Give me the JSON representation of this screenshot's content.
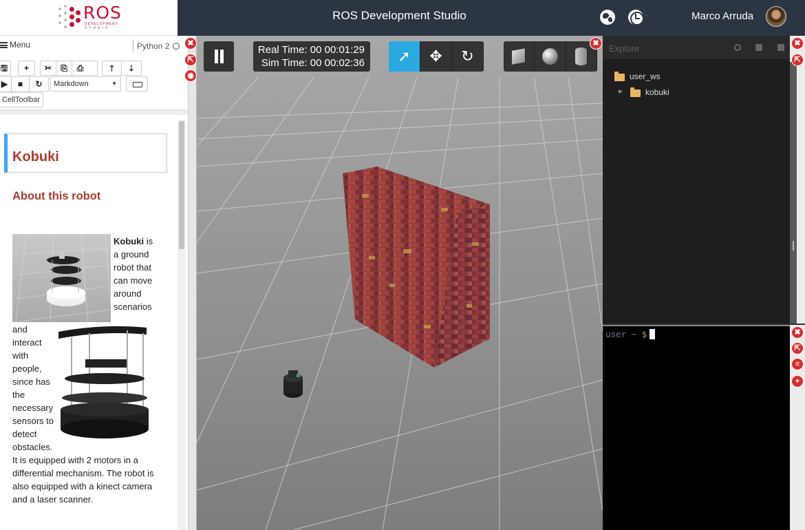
{
  "header": {
    "logo_text": "ROS",
    "logo_sub1": "DEVELOPMENT",
    "logo_sub2": "STUDIO",
    "title": "ROS Development Studio",
    "user_name": "Marco Arruda"
  },
  "notebook": {
    "menu_label": "Menu",
    "kernel": "Python 2",
    "cell_type": "Markdown",
    "celltoolbar_label": "CellToolbar",
    "heading": "Kobuki",
    "subheading": "About this robot",
    "intro_bold": "Kobuki",
    "intro_lines": [
      "is",
      "a ground",
      "robot that",
      "can move",
      "around",
      "scenarios"
    ],
    "wrap_lines": [
      "and",
      "interact",
      "with",
      "people,",
      "since has",
      "the",
      "necessary",
      "sensors to",
      "detect",
      "obstacles."
    ],
    "footer_lines": [
      "It is equipped with 2 motors in a",
      "differential mechanism. The robot is",
      "also equipped with a kinect camera",
      "and a laser scanner."
    ]
  },
  "simulation": {
    "real_time": "Real Time: 00 00:01:29",
    "sim_time": "Sim Time: 00 00:02:36"
  },
  "explorer": {
    "placeholder": "Explore",
    "tree": [
      {
        "label": "user_ws"
      },
      {
        "label": "kobuki"
      }
    ]
  },
  "terminal": {
    "prompt_user": "user ~",
    "prompt_symbol": "$"
  },
  "colors": {
    "accent": "#29a9e0",
    "brand": "#c8102e",
    "close_red": "#d32f2f",
    "heading_red": "#b03a2e"
  },
  "icons": {
    "header": [
      "globe-icon",
      "clock-icon"
    ],
    "gazebo_modes": [
      "select-arrow-icon",
      "translate-icon",
      "rotate-icon"
    ],
    "gazebo_shapes": [
      "box-icon",
      "sphere-icon",
      "cylinder-icon"
    ]
  }
}
